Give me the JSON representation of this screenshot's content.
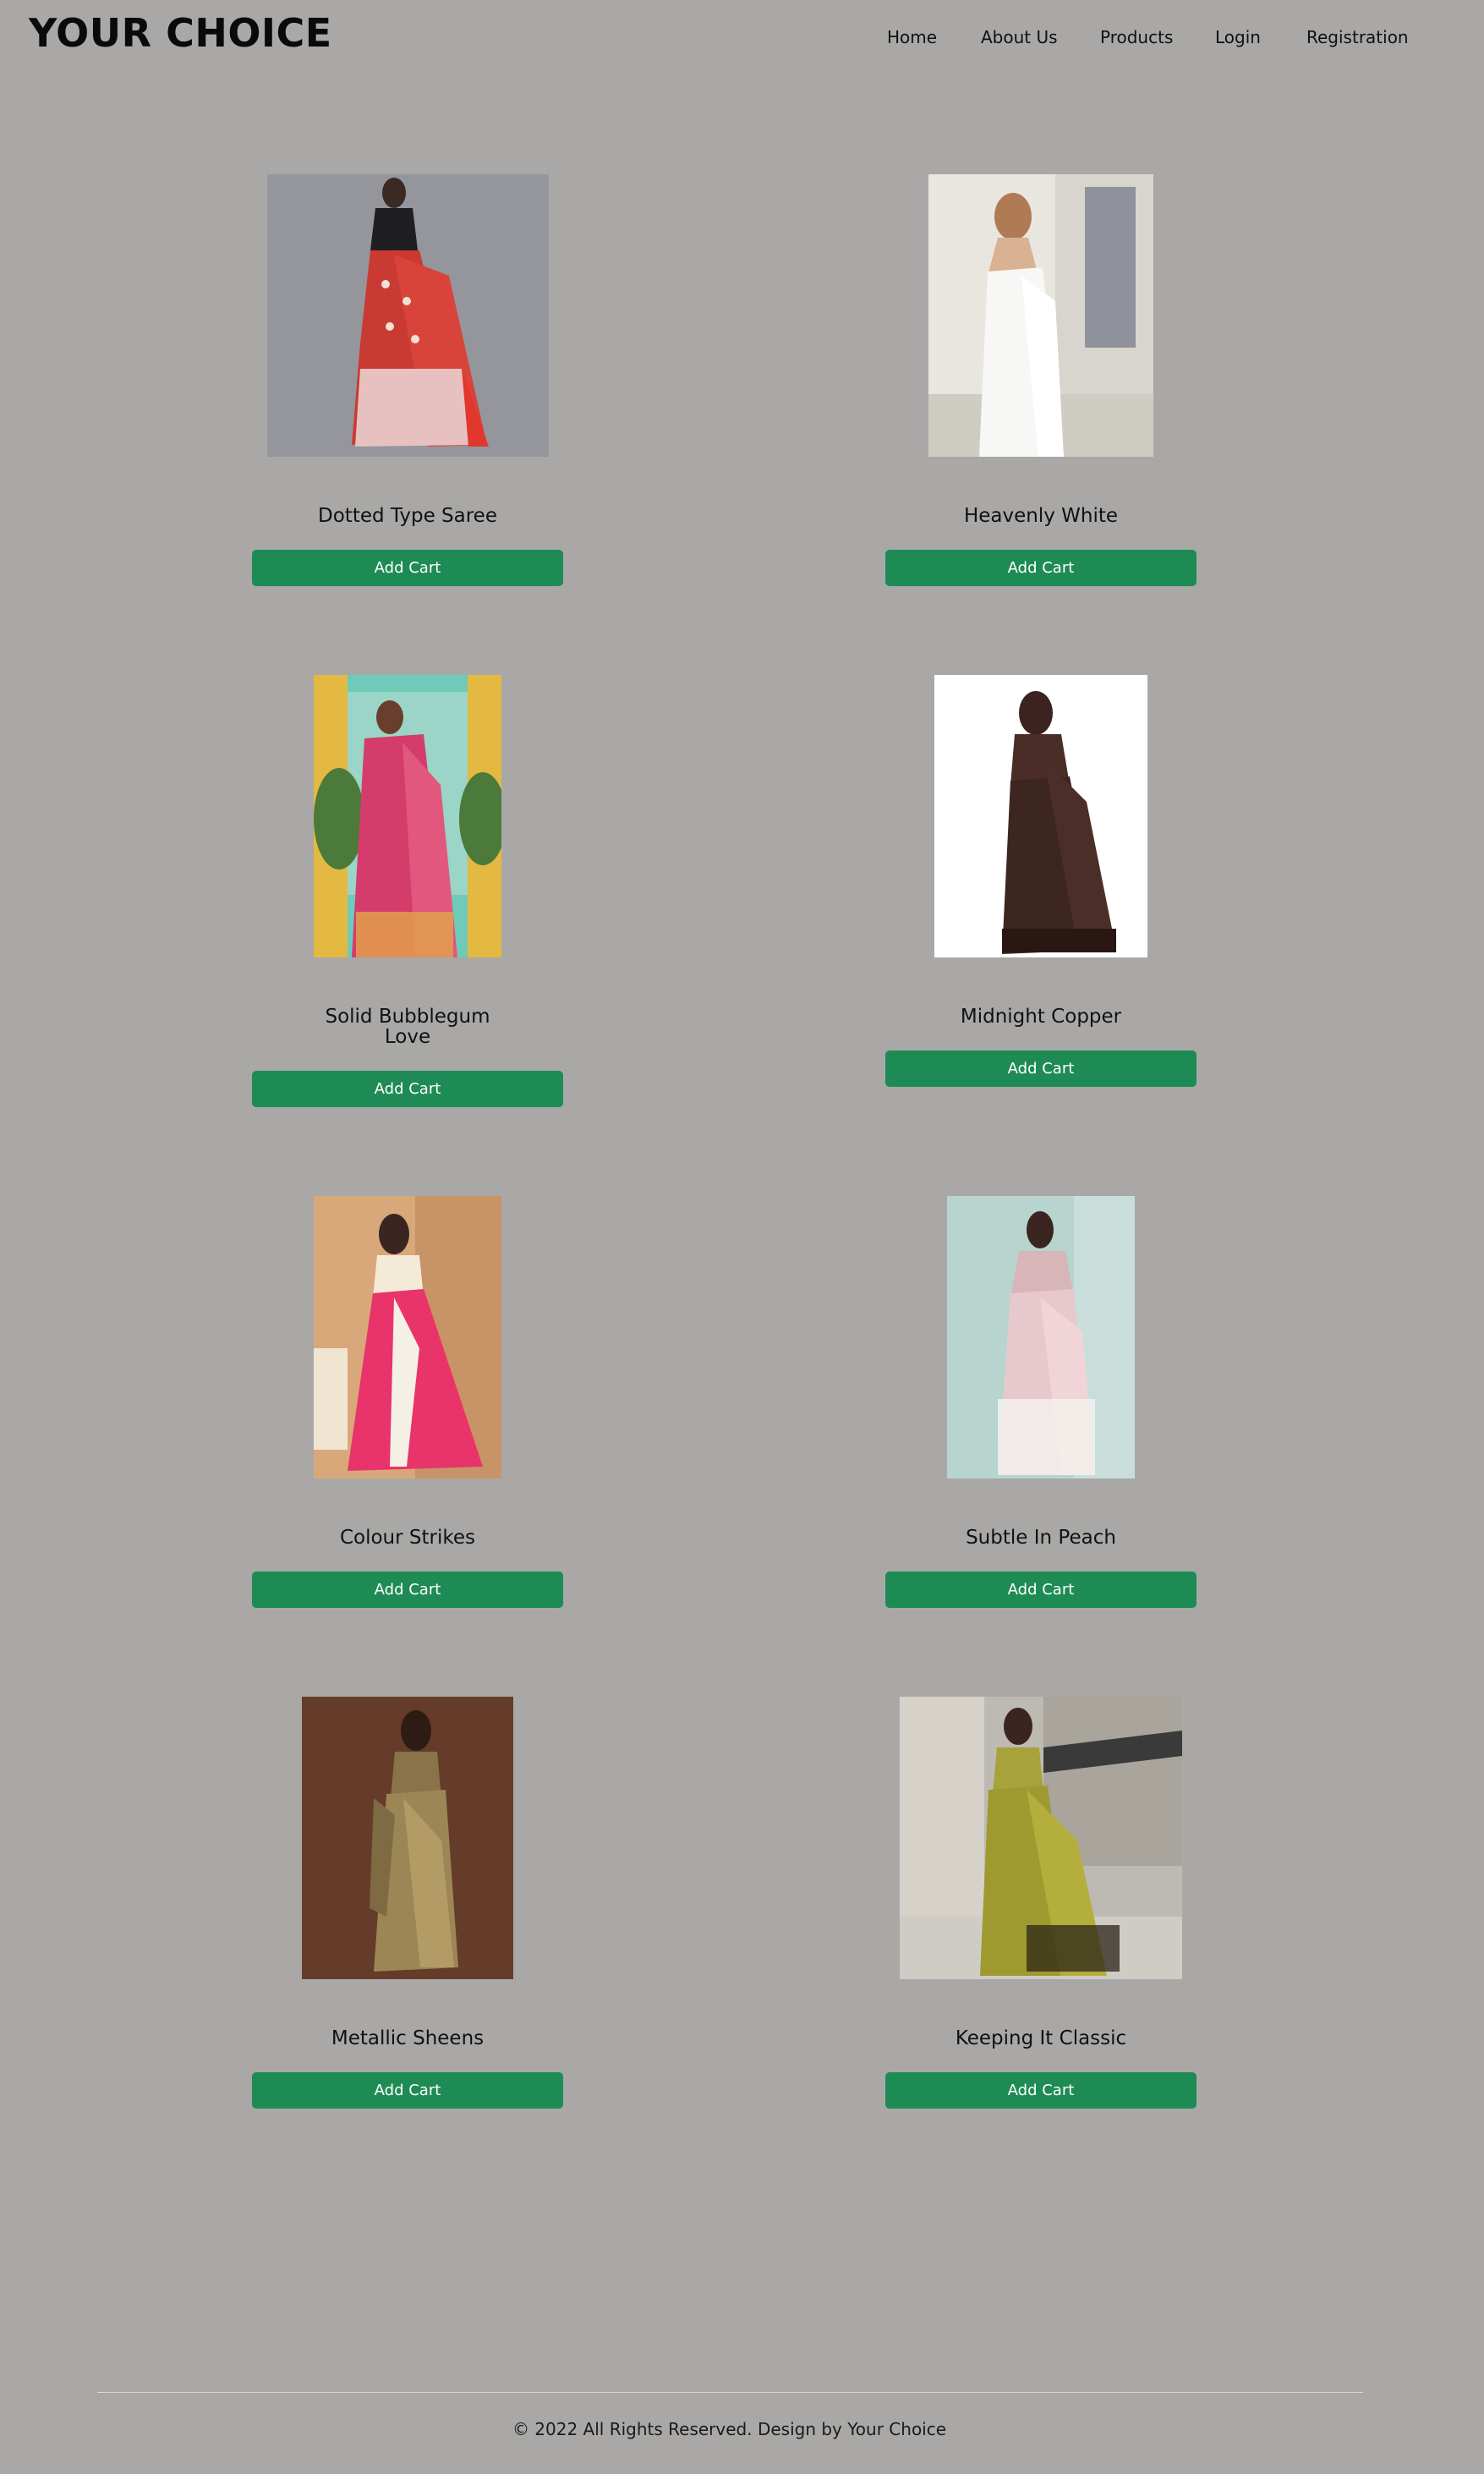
{
  "header": {
    "brand": "YOUR CHOICE",
    "nav": [
      "Home",
      "About Us",
      "Products",
      "Login",
      "Registration"
    ]
  },
  "products": [
    {
      "name": "Dotted Type Saree",
      "button": "Add Cart",
      "image": "saree-red-dotted"
    },
    {
      "name": "Heavenly White",
      "button": "Add Cart",
      "image": "saree-white"
    },
    {
      "name": "Solid Bubblegum Love",
      "button": "Add Cart",
      "image": "saree-pink-gold"
    },
    {
      "name": "Midnight Copper",
      "button": "Add Cart",
      "image": "saree-brown"
    },
    {
      "name": "Colour Strikes",
      "button": "Add Cart",
      "image": "saree-hot-pink"
    },
    {
      "name": "Subtle In Peach",
      "button": "Add Cart",
      "image": "saree-peach"
    },
    {
      "name": "Metallic Sheens",
      "button": "Add Cart",
      "image": "saree-metallic-gold"
    },
    {
      "name": "Keeping It Classic",
      "button": "Add Cart",
      "image": "saree-olive-green"
    }
  ],
  "footer": {
    "text": "© 2022 All Rights Reserved. Design by Your Choice"
  },
  "colors": {
    "background": "#a9a8a7",
    "button": "#1e8b55",
    "button_text": "#ffffff"
  }
}
